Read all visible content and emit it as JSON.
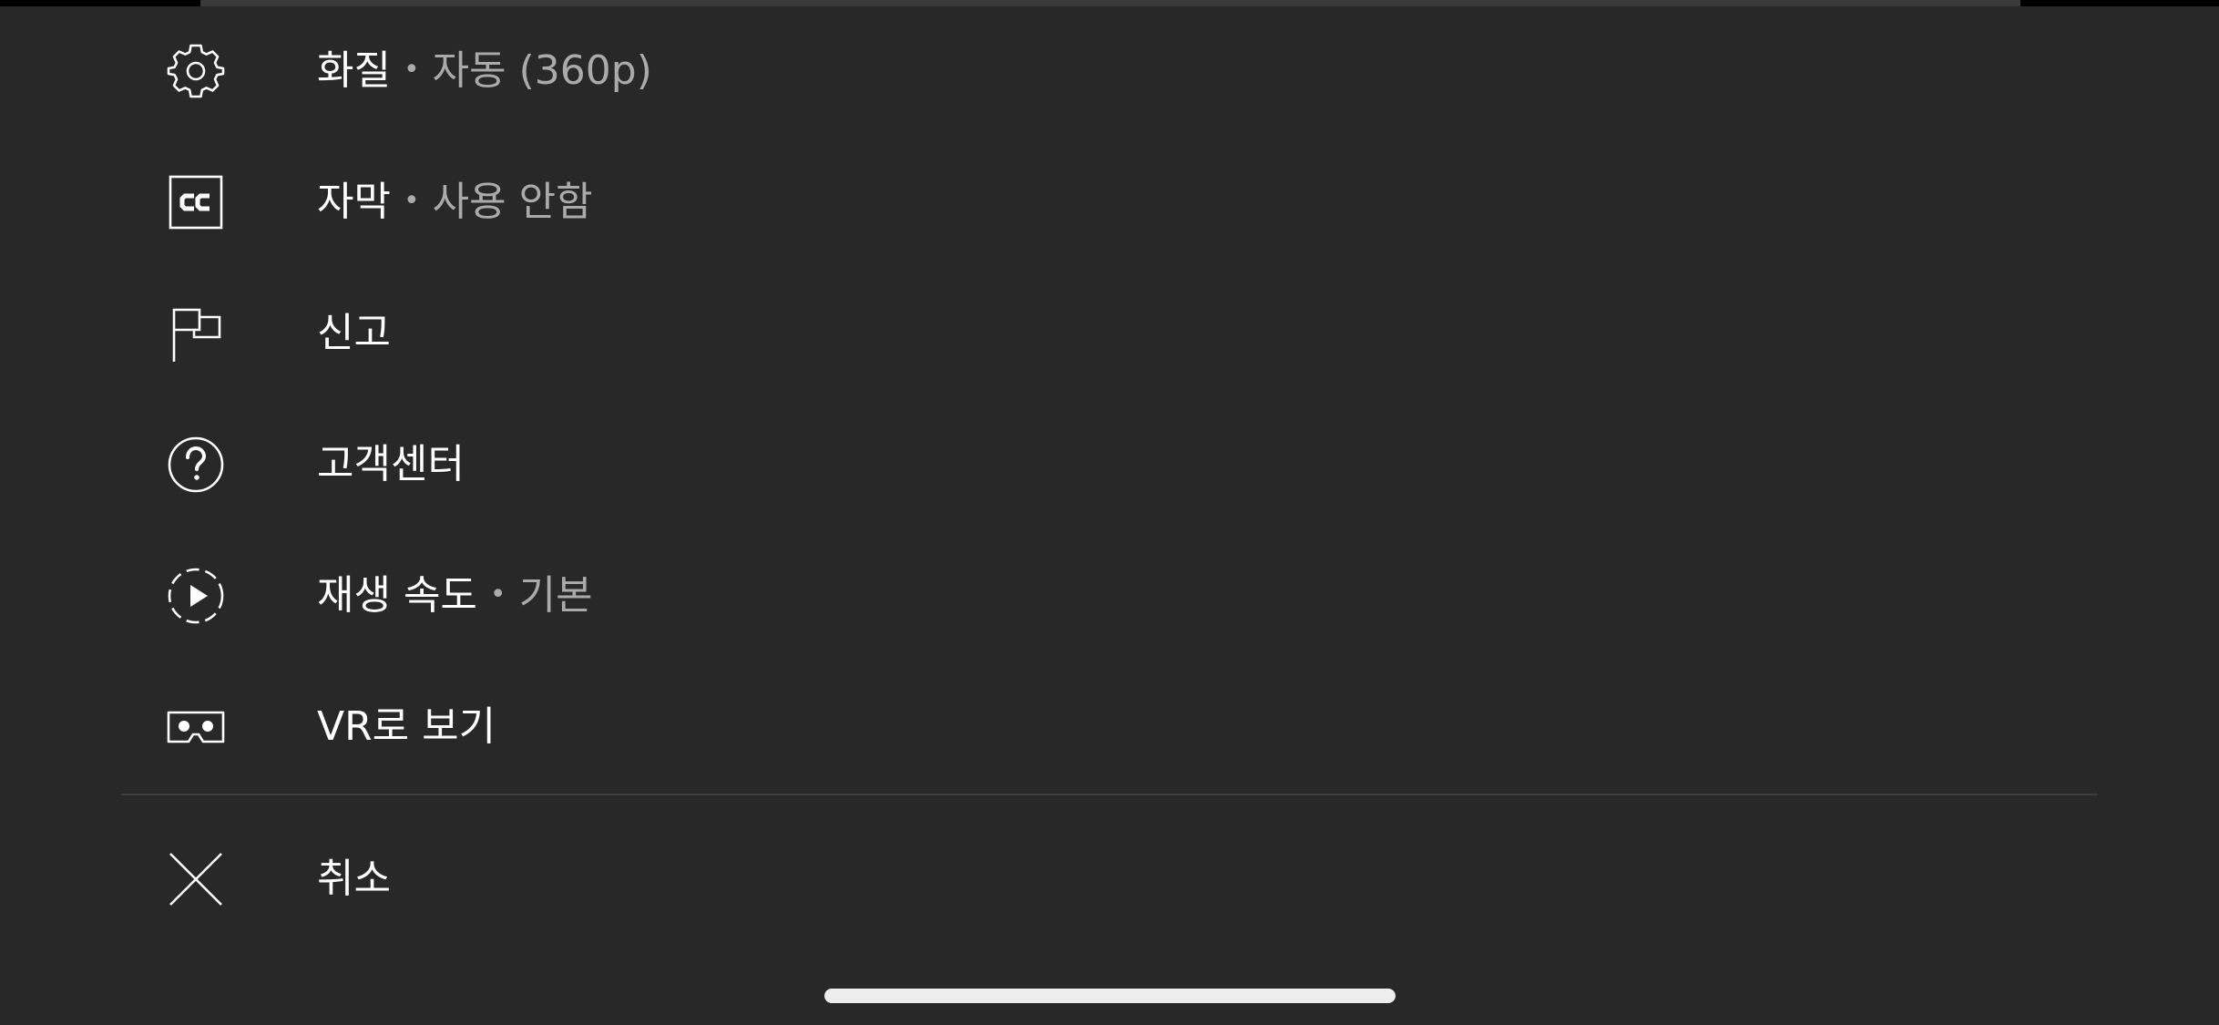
{
  "menu": {
    "items": [
      {
        "icon": "gear-icon",
        "label": "화질",
        "separator": "•",
        "value": "자동 (360p)"
      },
      {
        "icon": "closed-captions-icon",
        "label": "자막",
        "separator": "•",
        "value": "사용 안함"
      },
      {
        "icon": "flag-icon",
        "label": "신고"
      },
      {
        "icon": "help-circle-icon",
        "label": "고객센터"
      },
      {
        "icon": "playback-speed-icon",
        "label": "재생 속도",
        "separator": "•",
        "value": "기본"
      },
      {
        "icon": "vr-headset-icon",
        "label": "VR로 보기"
      }
    ],
    "cancel": {
      "icon": "close-icon",
      "label": "취소"
    }
  },
  "colors": {
    "background": "#282828",
    "text_primary": "#ffffff",
    "text_secondary": "#aaaaaa",
    "divider": "#3e3e3e",
    "home_indicator": "#ededed"
  }
}
